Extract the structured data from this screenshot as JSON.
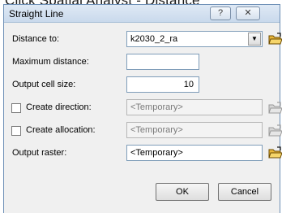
{
  "background": {
    "cropped_text": "Click Spatial Analyst - Distance"
  },
  "dialog": {
    "title": "Straight Line",
    "help_glyph": "?",
    "close_glyph": "✕"
  },
  "form": {
    "distance_to": {
      "label": "Distance to:",
      "value": "k2030_2_ra"
    },
    "maximum_distance": {
      "label": "Maximum distance:",
      "value": ""
    },
    "output_cell_size": {
      "label": "Output cell size:",
      "value": "10"
    },
    "create_direction": {
      "label": "Create direction:",
      "checked": false,
      "value": "<Temporary>"
    },
    "create_allocation": {
      "label": "Create allocation:",
      "checked": false,
      "value": "<Temporary>"
    },
    "output_raster": {
      "label": "Output raster:",
      "value": "<Temporary>"
    }
  },
  "buttons": {
    "ok": "OK",
    "cancel": "Cancel"
  },
  "icons": {
    "folder": "open-folder-icon",
    "dropdown": "chevron-down-icon"
  },
  "colors": {
    "folder_enabled": "#e8b63a",
    "folder_disabled": "#c8c8c8"
  }
}
